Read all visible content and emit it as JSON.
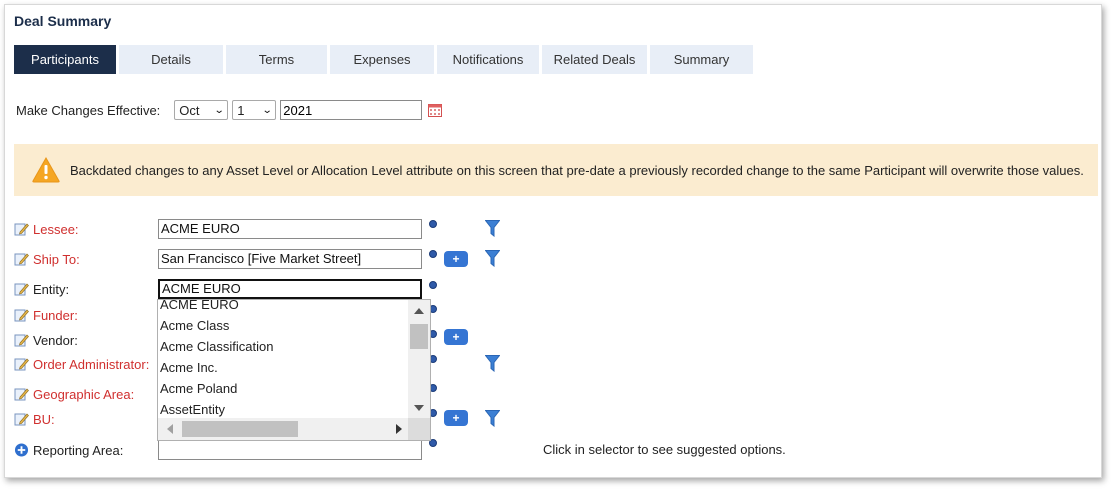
{
  "title": "Deal Summary",
  "tabs": [
    {
      "label": "Participants",
      "active": true
    },
    {
      "label": "Details"
    },
    {
      "label": "Terms"
    },
    {
      "label": "Expenses"
    },
    {
      "label": "Notifications"
    },
    {
      "label": "Related Deals"
    },
    {
      "label": "Summary"
    }
  ],
  "effective": {
    "label": "Make Changes Effective:",
    "month": "Oct",
    "day": "1",
    "year": "2021"
  },
  "warning": {
    "text": "Backdated changes to any Asset Level or Allocation Level attribute on this screen that pre-date a previously recorded change to the same Participant will overwrite those values."
  },
  "fields": [
    {
      "label": "Lessee:",
      "value": "ACME EURO",
      "required": true
    },
    {
      "label": "Ship To:",
      "value": "San Francisco [Five Market Street]",
      "required": true
    },
    {
      "label": "Entity:",
      "value": "ACME EURO",
      "required": false
    },
    {
      "label": "Funder:",
      "value": "",
      "required": true
    },
    {
      "label": "Vendor:",
      "value": "",
      "required": false
    },
    {
      "label": "Order Administrator:",
      "value": "",
      "required": true
    },
    {
      "label": "Geographic Area:",
      "value": "",
      "required": true
    },
    {
      "label": "BU:",
      "value": "",
      "required": true
    },
    {
      "label": "Reporting Area:",
      "value": "",
      "required": false
    }
  ],
  "dropdown": {
    "items": [
      "ACME EURO",
      "Acme Class",
      "Acme Classification",
      "Acme Inc.",
      "Acme Poland",
      "AssetEntity"
    ]
  },
  "hint": "Click in selector to see suggested options.",
  "plus_label": "+",
  "colors": {
    "active_tab": "#1c2e4a",
    "tab_bg": "#e8eef7",
    "warning_bg": "#fbecd0",
    "required": "#d0302f",
    "accent": "#3575d3"
  }
}
